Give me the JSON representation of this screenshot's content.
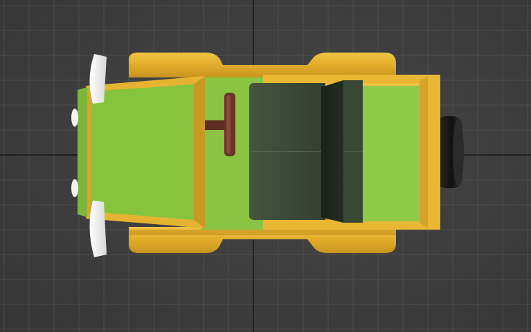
{
  "viewport": {
    "view": "top",
    "show_grid": true,
    "background_color": "#3f3f3f",
    "grid_color": "#5a5a5a",
    "axis_color": "#111111"
  },
  "model": {
    "name": "toy car",
    "colors": {
      "body": "#e6b231",
      "body_shadow": "#b8891c",
      "green_panel": "#86c43e",
      "green_light": "#97d04f",
      "seat": "#3e4c3b",
      "seat_dark": "#1d261b",
      "steering_wheel": "#5a2a22",
      "bumper": "#f2f2f2",
      "tire": "#1a1a1a"
    }
  }
}
